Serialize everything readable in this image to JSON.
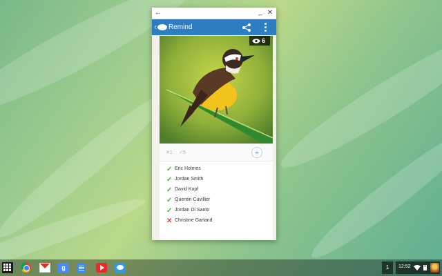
{
  "window": {
    "back_icon": "arrow-left-icon",
    "minimize_icon": "minimize-icon",
    "close_icon": "close-icon",
    "back_glyph": "←",
    "minimize_glyph": "_",
    "close_glyph": "✕"
  },
  "app_bar": {
    "title": "Remind",
    "brand_color": "#2f7dc1",
    "logo_icon": "remind-bubble-icon",
    "share_icon": "share-icon",
    "more_icon": "more-vertical-icon"
  },
  "message": {
    "image": "yellow-bellied bird perched on green leaf",
    "view_count": "6",
    "stats": {
      "declined": "1",
      "confirmed": "5"
    },
    "star_icon": "star-icon",
    "star_glyph": "★",
    "x_glyph": "✕",
    "check_glyph": "✓"
  },
  "recipients": [
    {
      "name": "Eric Holmes",
      "status": "confirmed"
    },
    {
      "name": "Jordan Smith",
      "status": "confirmed"
    },
    {
      "name": "David Kopf",
      "status": "confirmed"
    },
    {
      "name": "Quentin Cuvillier",
      "status": "confirmed"
    },
    {
      "name": "Jordan Di Santo",
      "status": "confirmed"
    },
    {
      "name": "Christine Garland",
      "status": "declined"
    }
  ],
  "status_colors": {
    "confirmed": "#4caf3f",
    "declined": "#e0403a"
  },
  "shelf": {
    "apps": [
      "launcher-icon",
      "chrome-icon",
      "gmail-icon",
      "google-plus-icon",
      "docs-icon",
      "youtube-icon",
      "remind-icon"
    ],
    "gplus_glyph": "g",
    "desk_number": "1",
    "time": "12:52",
    "tray_icons": [
      "wifi-icon",
      "battery-icon",
      "avatar"
    ]
  }
}
